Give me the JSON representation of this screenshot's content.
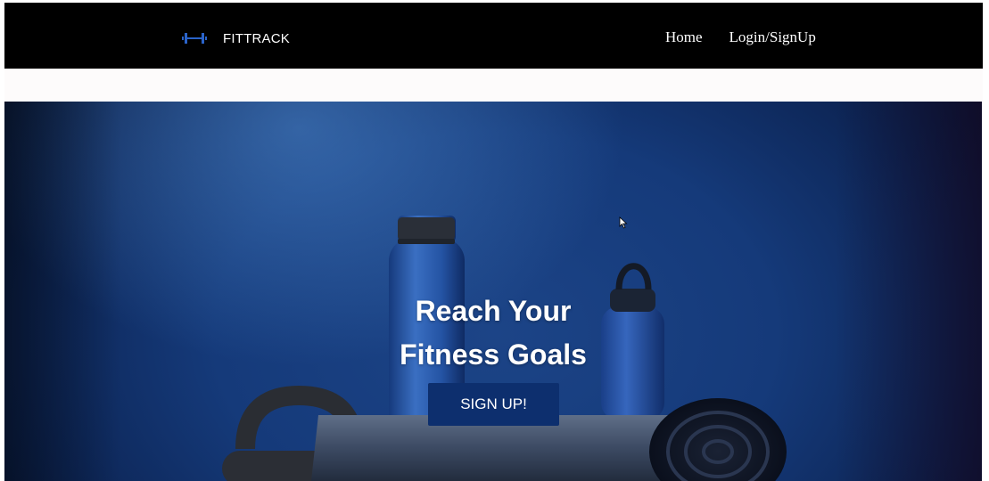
{
  "header": {
    "brand_name": "FITTRACK",
    "logo_icon": "dumbbell-icon",
    "nav": [
      {
        "label": "Home"
      },
      {
        "label": "Login/SignUp"
      }
    ]
  },
  "hero": {
    "title_line1": "Reach Your",
    "title_line2": "Fitness Goals",
    "cta_label": "SIGN UP!",
    "background_image": "blue water bottles, kettlebell and rolled yoga mat"
  },
  "colors": {
    "navbar_bg": "#000000",
    "accent": "#1f4fa3",
    "hero_bg": "#153a7a",
    "button_bg": "#0d2f6e"
  }
}
